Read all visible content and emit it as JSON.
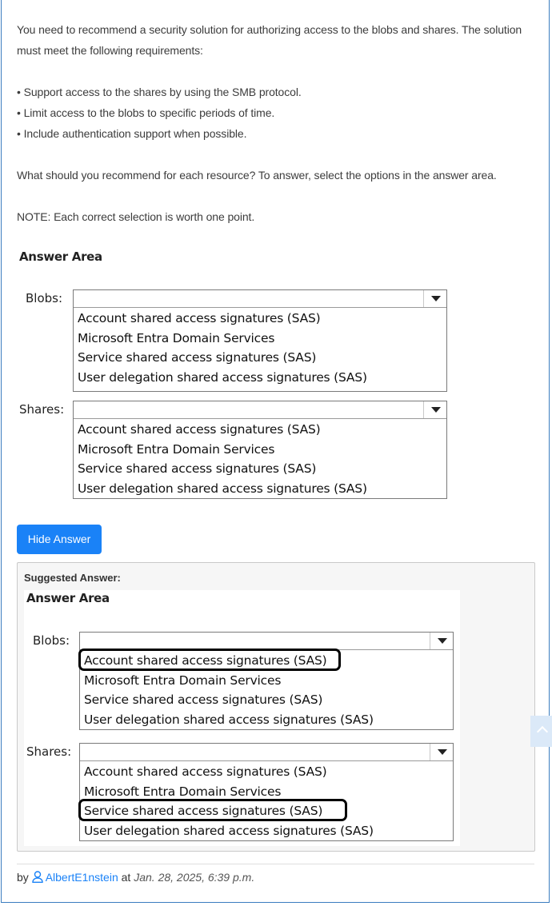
{
  "question": {
    "intro": "You need to recommend a security solution for authorizing access to the blobs and shares. The solution must meet the following requirements:",
    "requirements": [
      "• Support access to the shares by using the SMB protocol.",
      "• Limit access to the blobs to specific periods of time.",
      "• Include authentication support when possible."
    ],
    "prompt": "What should you recommend for each resource? To answer, select the options in the answer area.",
    "note": "NOTE: Each correct selection is worth one point."
  },
  "answer_area": {
    "title": "Answer Area",
    "blobs_label": "Blobs:",
    "shares_label": "Shares:",
    "options": [
      "Account shared access signatures (SAS)",
      "Microsoft Entra Domain Services",
      "Service shared access signatures (SAS)",
      "User delegation shared access signatures (SAS)"
    ]
  },
  "hide_answer_button": "Hide Answer",
  "suggested": {
    "label": "Suggested Answer:",
    "title": "Answer Area",
    "blobs_label": "Blobs:",
    "shares_label": "Shares:",
    "blobs_selected": "Account shared access signatures (SAS)",
    "shares_selected": "Service shared access signatures (SAS)"
  },
  "byline": {
    "by": "by",
    "user": "AlbertE1nstein",
    "at": "at",
    "date": "Jan. 28, 2025, 6:39 p.m."
  },
  "icons": {
    "user": "user-outline-icon",
    "dropdown": "chevron-down-icon",
    "scroll_top": "chevron-up-icon"
  },
  "colors": {
    "button": "#1a82f7",
    "link": "#1a82f7",
    "frame_border": "#3b7dbf"
  }
}
